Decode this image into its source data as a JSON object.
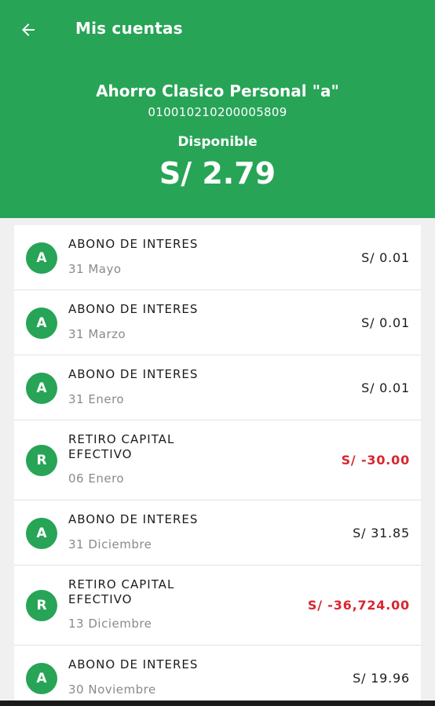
{
  "header": {
    "title": "Mis cuentas",
    "back_icon": "arrow-left-icon",
    "account_name": "Ahorro Clasico Personal \"a\"",
    "account_number": "010010210200005809",
    "available_label": "Disponible",
    "available_amount": "S/ 2.79"
  },
  "colors": {
    "brand_green": "#27a456",
    "negative_red": "#d8262e"
  },
  "transactions": [
    {
      "initial": "A",
      "description": "ABONO DE INTERES",
      "date": "31 Mayo",
      "amount": "S/ 0.01",
      "negative": false
    },
    {
      "initial": "A",
      "description": "ABONO DE INTERES",
      "date": "31 Marzo",
      "amount": "S/ 0.01",
      "negative": false
    },
    {
      "initial": "A",
      "description": "ABONO DE INTERES",
      "date": "31 Enero",
      "amount": "S/ 0.01",
      "negative": false
    },
    {
      "initial": "R",
      "description": "RETIRO CAPITAL\nEFECTIVO",
      "date": "06 Enero",
      "amount": "S/ -30.00",
      "negative": true
    },
    {
      "initial": "A",
      "description": "ABONO DE INTERES",
      "date": "31 Diciembre",
      "amount": "S/ 31.85",
      "negative": false
    },
    {
      "initial": "R",
      "description": "RETIRO CAPITAL\nEFECTIVO",
      "date": "13 Diciembre",
      "amount": "S/ -36,724.00",
      "negative": true
    },
    {
      "initial": "A",
      "description": "ABONO DE INTERES",
      "date": "30 Noviembre",
      "amount": "S/ 19.96",
      "negative": false
    }
  ]
}
